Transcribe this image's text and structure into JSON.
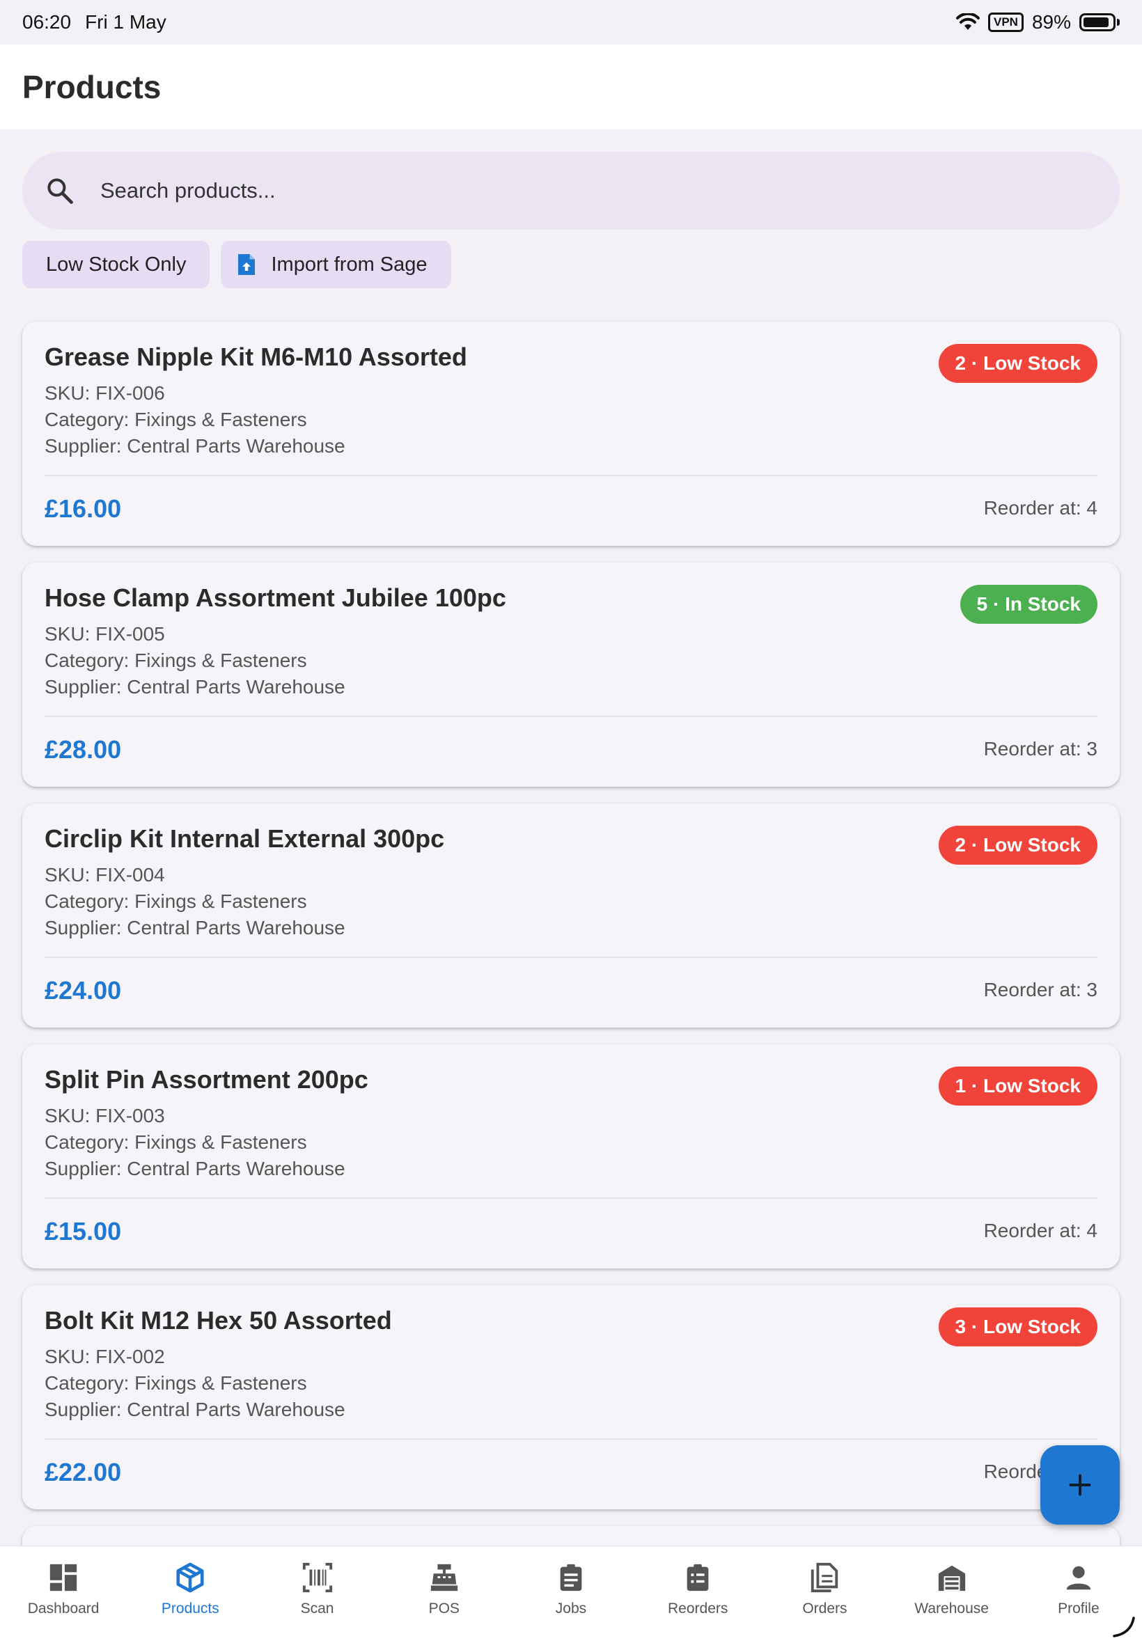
{
  "status_bar": {
    "time": "06:20",
    "date": "Fri 1 May",
    "vpn": "VPN",
    "battery": "89%",
    "battery_level": 0.89
  },
  "app_bar": {
    "title": "Products"
  },
  "search": {
    "placeholder": "Search products..."
  },
  "filters": {
    "low_stock": "Low Stock Only",
    "import": "Import from Sage"
  },
  "products": [
    {
      "name": "Grease Nipple Kit M6-M10 Assorted",
      "sku": "SKU: FIX-006",
      "category": "Category: Fixings & Fasteners",
      "supplier": "Supplier: Central Parts Warehouse",
      "price": "£16.00",
      "reorder": "Reorder at: 4",
      "badge": "2 · Low Stock",
      "badge_color": "#f0443a"
    },
    {
      "name": "Hose Clamp Assortment Jubilee 100pc",
      "sku": "SKU: FIX-005",
      "category": "Category: Fixings & Fasteners",
      "supplier": "Supplier: Central Parts Warehouse",
      "price": "£28.00",
      "reorder": "Reorder at: 3",
      "badge": "5 · In Stock",
      "badge_color": "#4caf50"
    },
    {
      "name": "Circlip Kit Internal External 300pc",
      "sku": "SKU: FIX-004",
      "category": "Category: Fixings & Fasteners",
      "supplier": "Supplier: Central Parts Warehouse",
      "price": "£24.00",
      "reorder": "Reorder at: 3",
      "badge": "2 · Low Stock",
      "badge_color": "#f0443a"
    },
    {
      "name": "Split Pin Assortment 200pc",
      "sku": "SKU: FIX-003",
      "category": "Category: Fixings & Fasteners",
      "supplier": "Supplier: Central Parts Warehouse",
      "price": "£15.00",
      "reorder": "Reorder at: 4",
      "badge": "1 · Low Stock",
      "badge_color": "#f0443a"
    },
    {
      "name": "Bolt Kit M12 Hex 50 Assorted",
      "sku": "SKU: FIX-002",
      "category": "Category: Fixings & Fasteners",
      "supplier": "Supplier: Central Parts Warehouse",
      "price": "£22.00",
      "reorder": "Reorder at: 4",
      "badge": "3 · Low Stock",
      "badge_color": "#f0443a"
    }
  ],
  "fab": {
    "icon": "plus-icon"
  },
  "nav": {
    "items": [
      {
        "label": "Dashboard",
        "icon": "dashboard-icon"
      },
      {
        "label": "Products",
        "icon": "products-icon"
      },
      {
        "label": "Scan",
        "icon": "barcode-icon"
      },
      {
        "label": "POS",
        "icon": "cash-register-icon"
      },
      {
        "label": "Jobs",
        "icon": "clipboard-icon"
      },
      {
        "label": "Reorders",
        "icon": "reorder-clipboard-icon"
      },
      {
        "label": "Orders",
        "icon": "document-icon"
      },
      {
        "label": "Warehouse",
        "icon": "warehouse-icon"
      },
      {
        "label": "Profile",
        "icon": "person-icon"
      }
    ]
  },
  "colors": {
    "accent": "#1e78d2",
    "low_stock": "#f0443a",
    "in_stock": "#4caf50",
    "chip": "#e6dcf4",
    "search_bg": "#ebe5f3"
  }
}
